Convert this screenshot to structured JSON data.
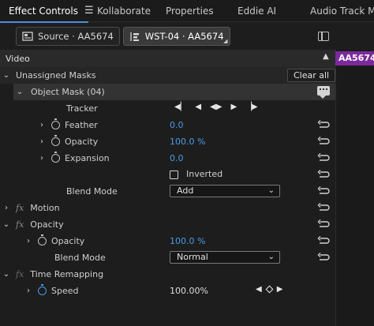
{
  "tabs": [
    {
      "label": "Effect Controls",
      "active": true
    },
    {
      "label": "Kollaborate"
    },
    {
      "label": "Properties"
    },
    {
      "label": "Eddie AI"
    },
    {
      "label": "Audio Track Mix"
    }
  ],
  "source_chip": "Source · AA5674",
  "sequence_chip": "WST-04 · AA5674",
  "timeline_clip": "AA5674",
  "section_video": "Video",
  "unassigned_masks": "Unassigned Masks",
  "clear_all": "Clear all",
  "object_mask": "Object Mask (04)",
  "tracker": "Tracker",
  "feather": {
    "label": "Feather",
    "value": "0.0"
  },
  "mask_opacity": {
    "label": "Opacity",
    "value": "100.0 %"
  },
  "expansion": {
    "label": "Expansion",
    "value": "0.0"
  },
  "inverted": "Inverted",
  "blend_mode_1": {
    "label": "Blend Mode",
    "value": "Add"
  },
  "motion": "Motion",
  "opacity_group": "Opacity",
  "opacity": {
    "label": "Opacity",
    "value": "100.0 %"
  },
  "blend_mode_2": {
    "label": "Blend Mode",
    "value": "Normal"
  },
  "time_remapping": "Time Remapping",
  "speed": {
    "label": "Speed",
    "value": "100.00%"
  },
  "icons": [
    "hamburger-menu-icon",
    "source-clip-icon",
    "sequence-icon",
    "panel-toggle-icon",
    "stopwatch-icon",
    "reset-icon",
    "fx-icon",
    "speech-bubble-icon",
    "keyframe-diamond-icon"
  ],
  "colors": {
    "accent_blue": "#4b9be8",
    "clip_purple": "#7b2a9c",
    "tab_underline": "#4b8fe2"
  }
}
